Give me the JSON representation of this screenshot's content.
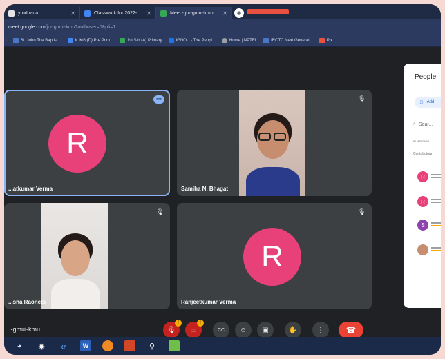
{
  "browser": {
    "tabs": [
      {
        "label": "yrodhana...",
        "active": false,
        "icon_color": "#e4e4e4"
      },
      {
        "label": "Classwork for 2022-23 KVBCC...",
        "active": false,
        "icon_color": "#4285f4"
      },
      {
        "label": "Meet - jnr-gmui-kmu",
        "active": true,
        "icon_color": "#34a853"
      }
    ],
    "url_host": "meet.google.com",
    "url_path": "/jnr-gmui-kmu?authuser=0&pli=1",
    "bookmarks": [
      {
        "label": "St. John The Baptist...",
        "color": "#4a76c8"
      },
      {
        "label": "Ir. KG (D) Pre Prim...",
        "color": "#4285f4"
      },
      {
        "label": "1st Std (A) Primary",
        "color": "#34a853"
      },
      {
        "label": "IGNOU - The Peopl...",
        "color": "#1a73e8"
      },
      {
        "label": "Home | NPTEL",
        "color": "#9aa0a6"
      },
      {
        "label": "IRCTC Next Generat...",
        "color": "#4a76c8"
      },
      {
        "label": "Pix",
        "color": "#e8503f"
      }
    ]
  },
  "meet": {
    "tiles": [
      {
        "name": "...atkumar Verma",
        "initial": "R",
        "type": "avatar"
      },
      {
        "name": "Samiha N. Bhagat",
        "type": "video"
      },
      {
        "name": "...sha Raonets",
        "type": "video"
      },
      {
        "name": "Ranjeetkumar Verma",
        "initial": "R",
        "type": "avatar"
      }
    ],
    "meeting_code": "...-gmui-kmu",
    "people_panel": {
      "title": "People",
      "chip": "Add",
      "search": "Sear...",
      "in_call": "IN MEETING",
      "contributors": "Contributors",
      "people": [
        {
          "initial": "R",
          "color": "#e8417a"
        },
        {
          "initial": "R",
          "color": "#e8417a"
        },
        {
          "initial": "S",
          "color": "#8e44ad"
        },
        {
          "initial": "",
          "color": "#c68d6e"
        }
      ]
    }
  },
  "controls": {
    "mic": "mic-off-icon",
    "cam": "cam-off-icon",
    "captions": "CC",
    "emoji": "☺",
    "present": "▣",
    "raise": "✋",
    "more": "⋮",
    "end": "end-call-icon"
  }
}
